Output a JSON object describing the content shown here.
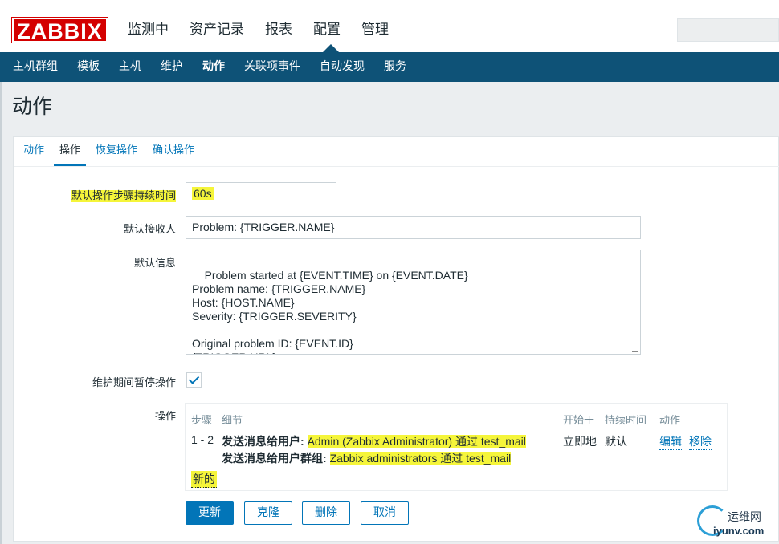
{
  "header": {
    "logo": "ZABBIX",
    "menu": [
      "监测中",
      "资产记录",
      "报表",
      "配置",
      "管理"
    ],
    "active_menu": "配置"
  },
  "subnav": {
    "items": [
      "主机群组",
      "模板",
      "主机",
      "维护",
      "动作",
      "关联项事件",
      "自动发现",
      "服务"
    ],
    "active": "动作"
  },
  "page": {
    "title": "动作"
  },
  "tabs": {
    "items": [
      "动作",
      "操作",
      "恢复操作",
      "确认操作"
    ],
    "active": "操作"
  },
  "form": {
    "step_duration_label": "默认操作步骤持续时间",
    "step_duration_value": "60s",
    "subject_label": "默认接收人",
    "subject_value": "Problem: {TRIGGER.NAME}",
    "message_label": "默认信息",
    "message_value": "Problem started at {EVENT.TIME} on {EVENT.DATE}\nProblem name: {TRIGGER.NAME}\nHost: {HOST.NAME}\nSeverity: {TRIGGER.SEVERITY}\n\nOriginal problem ID: {EVENT.ID}\n{TRIGGER.URL}",
    "pause_label": "维护期间暂停操作",
    "pause_checked": true,
    "operations_label": "操作"
  },
  "operations": {
    "headers": {
      "steps": "步骤",
      "details": "细节",
      "start_in": "开始于",
      "duration": "持续时间",
      "action": "动作"
    },
    "rows": [
      {
        "steps": "1 - 2",
        "detail_user_label": "发送消息给用户:",
        "detail_user_value": "Admin (Zabbix Administrator) 通过 test_mail",
        "detail_group_label": "发送消息给用户群组:",
        "detail_group_value": "Zabbix administrators 通过 test_mail",
        "start_in": "立即地",
        "duration": "默认",
        "edit": "编辑",
        "remove": "移除"
      }
    ],
    "new_label": "新的"
  },
  "buttons": {
    "update": "更新",
    "clone": "克隆",
    "delete": "删除",
    "cancel": "取消"
  },
  "watermark": {
    "top": "运维网",
    "bottom": "iyunv.com"
  }
}
